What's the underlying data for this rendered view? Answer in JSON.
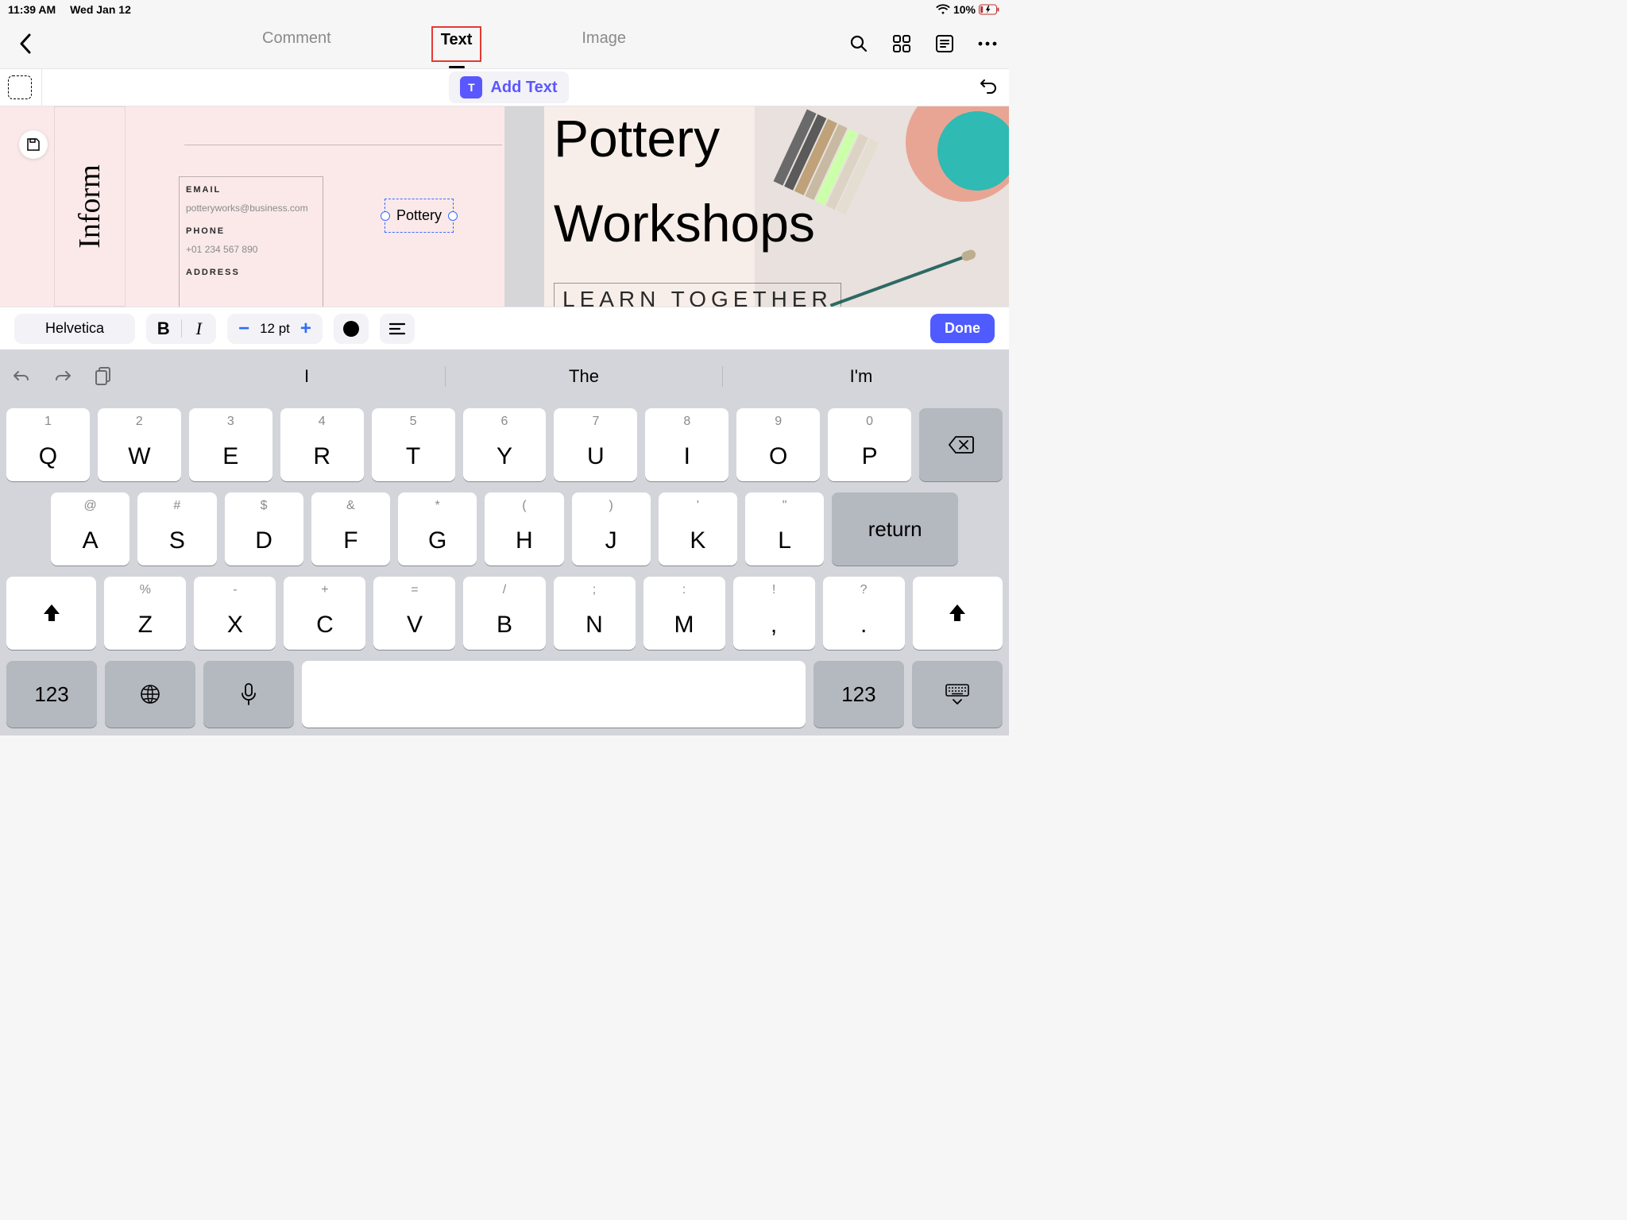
{
  "status": {
    "time": "11:39 AM",
    "date": "Wed Jan 12",
    "battery": "10%"
  },
  "nav": {
    "tabs": {
      "comment": "Comment",
      "text": "Text",
      "image": "Image"
    },
    "addText": "Add Text"
  },
  "document": {
    "leftPage": {
      "verticalLabel": "Inform",
      "emailLabel": "EMAIL",
      "emailValue": "potteryworks@business.com",
      "phoneLabel": "PHONE",
      "phoneValue": "+01 234 567 890",
      "addressLabel": "ADDRESS",
      "activeText": "Pottery"
    },
    "rightPage": {
      "title1": "Pottery",
      "title2": "Workshops",
      "subtitle": "LEARN TOGETHER"
    }
  },
  "format": {
    "fontName": "Helvetica",
    "bold": "B",
    "italic": "I",
    "minus": "−",
    "size": "12 pt",
    "plus": "+",
    "done": "Done"
  },
  "suggest": {
    "a": "I",
    "b": "The",
    "c": "I'm"
  },
  "keys": {
    "row1": [
      {
        "m": "Q",
        "a": "1"
      },
      {
        "m": "W",
        "a": "2"
      },
      {
        "m": "E",
        "a": "3"
      },
      {
        "m": "R",
        "a": "4"
      },
      {
        "m": "T",
        "a": "5"
      },
      {
        "m": "Y",
        "a": "6"
      },
      {
        "m": "U",
        "a": "7"
      },
      {
        "m": "I",
        "a": "8"
      },
      {
        "m": "O",
        "a": "9"
      },
      {
        "m": "P",
        "a": "0"
      }
    ],
    "row2": [
      {
        "m": "A",
        "a": "@"
      },
      {
        "m": "S",
        "a": "#"
      },
      {
        "m": "D",
        "a": "$"
      },
      {
        "m": "F",
        "a": "&"
      },
      {
        "m": "G",
        "a": "*"
      },
      {
        "m": "H",
        "a": "("
      },
      {
        "m": "J",
        "a": ")"
      },
      {
        "m": "K",
        "a": "'"
      },
      {
        "m": "L",
        "a": "\""
      }
    ],
    "row3": [
      {
        "m": "Z",
        "a": "%"
      },
      {
        "m": "X",
        "a": "-"
      },
      {
        "m": "C",
        "a": "+"
      },
      {
        "m": "V",
        "a": "="
      },
      {
        "m": "B",
        "a": "/"
      },
      {
        "m": "N",
        "a": ";"
      },
      {
        "m": "M",
        "a": ":"
      },
      {
        "m": ",",
        "a": "!"
      },
      {
        "m": ".",
        "a": "?"
      }
    ],
    "return": "return",
    "num": "123"
  }
}
